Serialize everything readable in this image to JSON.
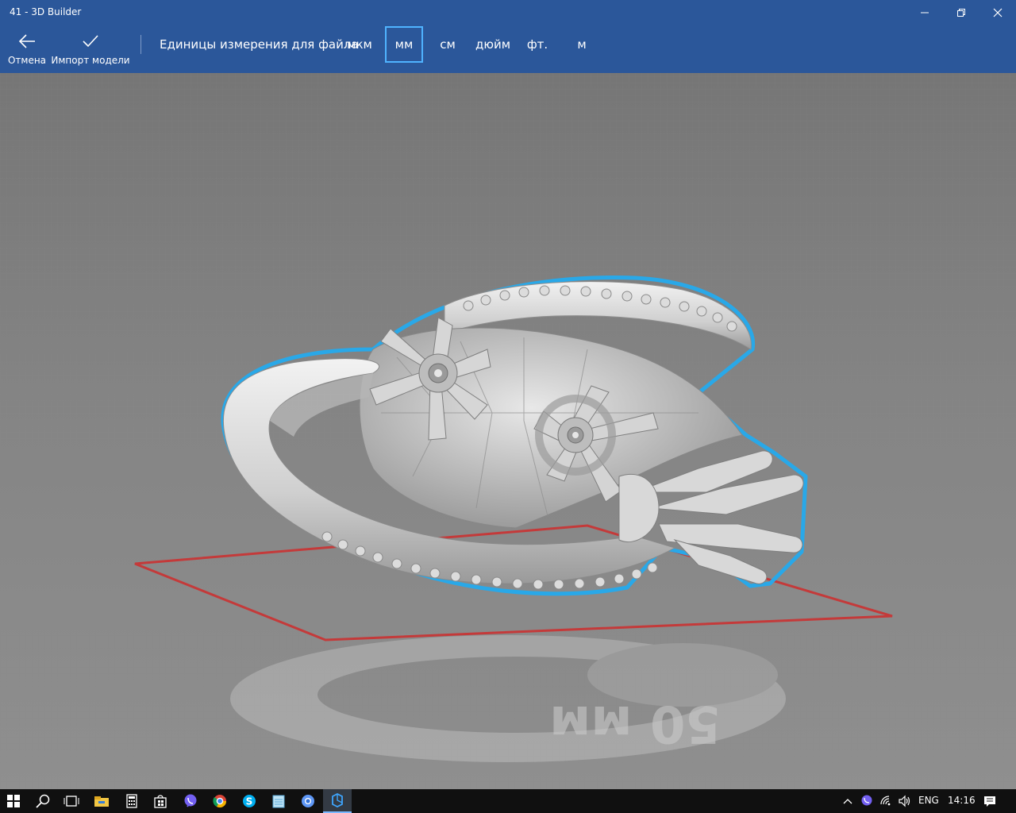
{
  "window": {
    "title": "41 - 3D Builder"
  },
  "toolbar": {
    "cancel_label": "Отмена",
    "import_label": "Импорт модели",
    "units_label": "Единицы измерения для файла",
    "units": [
      "мкм",
      "мм",
      "см",
      "дюйм",
      "фт.",
      "м"
    ],
    "selected_unit": "мм"
  },
  "viewport": {
    "ground_label": "50 мм",
    "model": "ring-with-flowers-and-hand",
    "selection_outline_color": "#29a8e8",
    "platform_color": "#c43a3a"
  },
  "taskbar": {
    "apps": [
      "start-icon",
      "search-icon",
      "task-view-icon",
      "file-explorer-icon",
      "calculator-icon",
      "store-icon",
      "viber-icon",
      "chrome-icon",
      "skype-icon",
      "notepad-icon",
      "chromium-icon",
      "3d-builder-icon"
    ],
    "language": "ENG",
    "time": "14:16"
  },
  "colors": {
    "accent": "#2b579a",
    "selection": "#4fb3ff",
    "taskbar": "#101010"
  }
}
